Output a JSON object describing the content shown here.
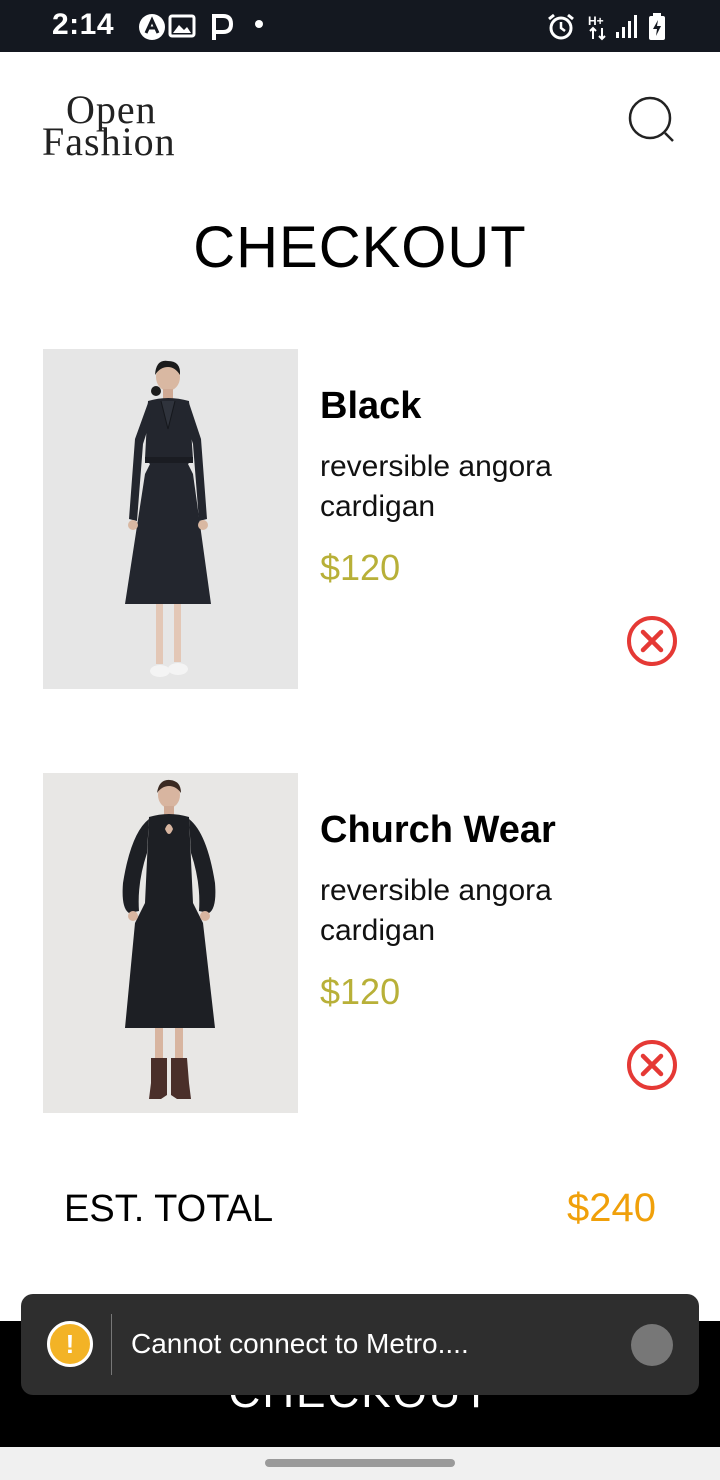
{
  "status_bar": {
    "time": "2:14",
    "left_icons": [
      "a-circle-icon",
      "image-icon",
      "p-icon",
      "dot-icon"
    ],
    "right_icons": [
      "alarm-icon",
      "data-icon",
      "signal-icon",
      "battery-icon"
    ]
  },
  "header": {
    "logo_line1": "Open",
    "logo_line2": "Fashion",
    "search_icon": "search-icon"
  },
  "page": {
    "title": "CHECKOUT"
  },
  "cart": {
    "items": [
      {
        "name": "Black",
        "description": "reversible angora cardigan",
        "price": "$120",
        "image": "woman-black-coat-dress-photo",
        "remove_icon": "close-circle-icon"
      },
      {
        "name": "Church Wear",
        "description": "reversible angora cardigan",
        "price": "$120",
        "image": "woman-black-midi-dress-photo",
        "remove_icon": "close-circle-icon"
      }
    ]
  },
  "summary": {
    "total_label": "EST. TOTAL",
    "total_value": "$240"
  },
  "checkout_button": {
    "label": "CHECKOUT"
  },
  "toast": {
    "icon": "warning-icon",
    "icon_glyph": "!",
    "message": "Cannot connect to Metro...."
  },
  "colors": {
    "price": "#b8b038",
    "total": "#f0a00a",
    "remove": "#e53935",
    "status_bar": "#141820",
    "toast_bg": "#2e2e2e",
    "warning": "#f3b326"
  }
}
